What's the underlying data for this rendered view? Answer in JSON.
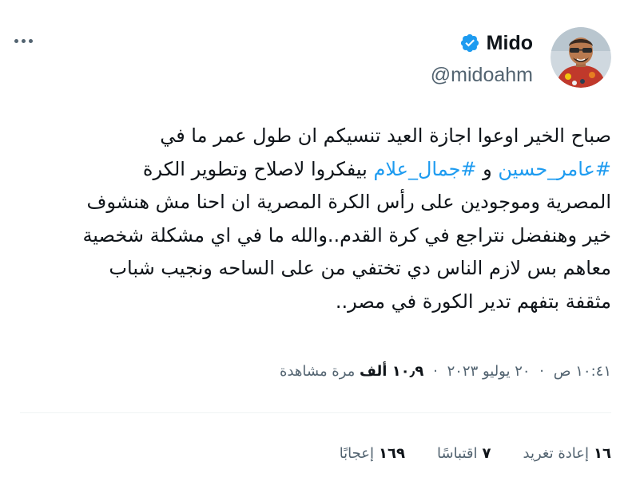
{
  "user": {
    "display_name": "Mido",
    "handle": "@midoahm",
    "verified": true,
    "verified_badge_color": "#1d9bf0"
  },
  "tweet": {
    "text_parts": [
      "صباح الخير اوعوا اجازة العيد تنسيكم ان طول عمر ما في",
      "#عامر_حسين",
      " و ",
      "#جمال_علام",
      " بيفكروا لاصلاح وتطوير الكرة",
      "المصرية وموجودين على رأس الكرة المصرية ان احنا مش هنشوف",
      "خير وهنفضل نتراجع في كرة القدم..والله ما في اي مشكلة شخصية",
      "معاهم بس لازم الناس دي تختفي من على الساحه ونجيب شباب",
      "مثقفة بتفهم تدير الكورة في مصر.."
    ]
  },
  "meta": {
    "time": "١٠:٤١ ص",
    "date": "٢٠ يوليو ٢٠٢٣",
    "separator": "·",
    "views_count": "١٠٫٩ ألف",
    "views_label": "مرة مشاهدة"
  },
  "stats": {
    "retweets_count": "١٦",
    "retweets_label": "إعادة تغريد",
    "quotes_count": "٧",
    "quotes_label": "اقتباسًا",
    "likes_count": "١٦٩",
    "likes_label": "إعجابًا"
  },
  "colors": {
    "link": "#1d9bf0",
    "text": "#0f1419",
    "secondary": "#536471",
    "divider": "#eff3f4"
  },
  "icons": {
    "more": "more-horizontal-icon",
    "verified": "verified-badge-icon"
  }
}
